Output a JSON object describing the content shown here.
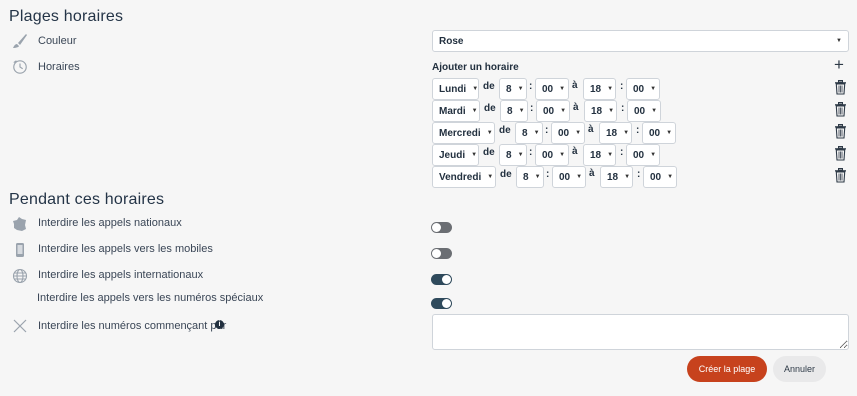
{
  "section_time": {
    "title": "Plages horaires"
  },
  "color_row": {
    "label": "Couleur",
    "value": "Rose"
  },
  "schedule_row": {
    "label": "Horaires",
    "add_label": "Ajouter un horaire"
  },
  "schedules": [
    {
      "day": "Lundi",
      "from_label": "de",
      "start_h": "8",
      "start_m": "00",
      "to_label": "à",
      "end_h": "18",
      "end_m": "00"
    },
    {
      "day": "Mardi",
      "from_label": "de",
      "start_h": "8",
      "start_m": "00",
      "to_label": "à",
      "end_h": "18",
      "end_m": "00"
    },
    {
      "day": "Mercredi",
      "from_label": "de",
      "start_h": "8",
      "start_m": "00",
      "to_label": "à",
      "end_h": "18",
      "end_m": "00"
    },
    {
      "day": "Jeudi",
      "from_label": "de",
      "start_h": "8",
      "start_m": "00",
      "to_label": "à",
      "end_h": "18",
      "end_m": "00"
    },
    {
      "day": "Vendredi",
      "from_label": "de",
      "start_h": "8",
      "start_m": "00",
      "to_label": "à",
      "end_h": "18",
      "end_m": "00"
    }
  ],
  "section_during": {
    "title": "Pendant ces horaires"
  },
  "restrictions": {
    "national": {
      "label": "Interdire les appels nationaux",
      "enabled": false
    },
    "mobile": {
      "label": "Interdire les appels vers les mobiles",
      "enabled": false
    },
    "international": {
      "label": "Interdire les appels internationaux",
      "enabled": true
    },
    "special": {
      "label": "Interdire les appels vers les numéros spéciaux",
      "enabled": true
    },
    "prefix": {
      "label": "Interdire les numéros commençant par",
      "value": ""
    }
  },
  "actions": {
    "create": "Créer la plage",
    "cancel": "Annuler"
  },
  "colors": {
    "accent": "#c7421d",
    "toggle_on": "#2f4a5c",
    "toggle_off": "#6b6e73",
    "background": "#f6f6f6"
  }
}
